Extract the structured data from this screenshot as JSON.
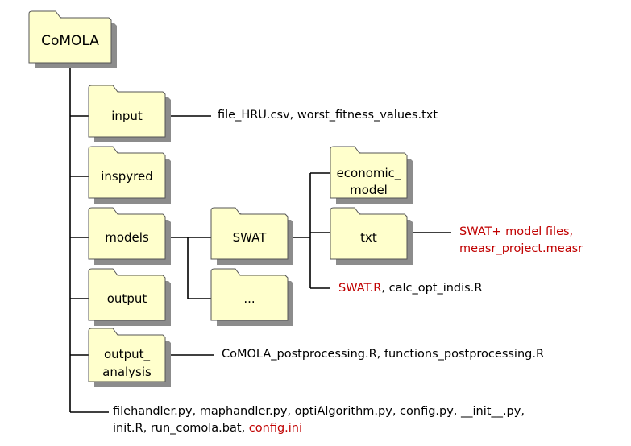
{
  "colors": {
    "folder_fill": "#ffffcc",
    "folder_stroke": "#555555",
    "shadow": "#8c8c8c",
    "highlight_text": "#c00000",
    "line": "#000000"
  },
  "folders": {
    "comola": "CoMOLA",
    "input": "input",
    "inspyred": "inspyred",
    "models": "models",
    "output": "output",
    "output_analysis_1": "output_",
    "output_analysis_2": "analysis",
    "swat": "SWAT",
    "ellipsis": "...",
    "economic_model_1": "economic_",
    "economic_model_2": "model",
    "txt": "txt"
  },
  "files": {
    "input": "file_HRU.csv,  worst_fitness_values.txt",
    "txt_line1": "SWAT+ model files,",
    "txt_line2": "measr_project.measr",
    "swat_red": "SWAT.R",
    "swat_rest": ", calc_opt_indis.R",
    "output_analysis": "CoMOLA_postprocessing.R,  functions_postprocessing.R",
    "root_line1": "filehandler.py, maphandler.py, optiAlgorithm.py, config.py, __init__.py,",
    "root_line2": "init.R, run_comola.bat, ",
    "root_red": "config.ini"
  }
}
